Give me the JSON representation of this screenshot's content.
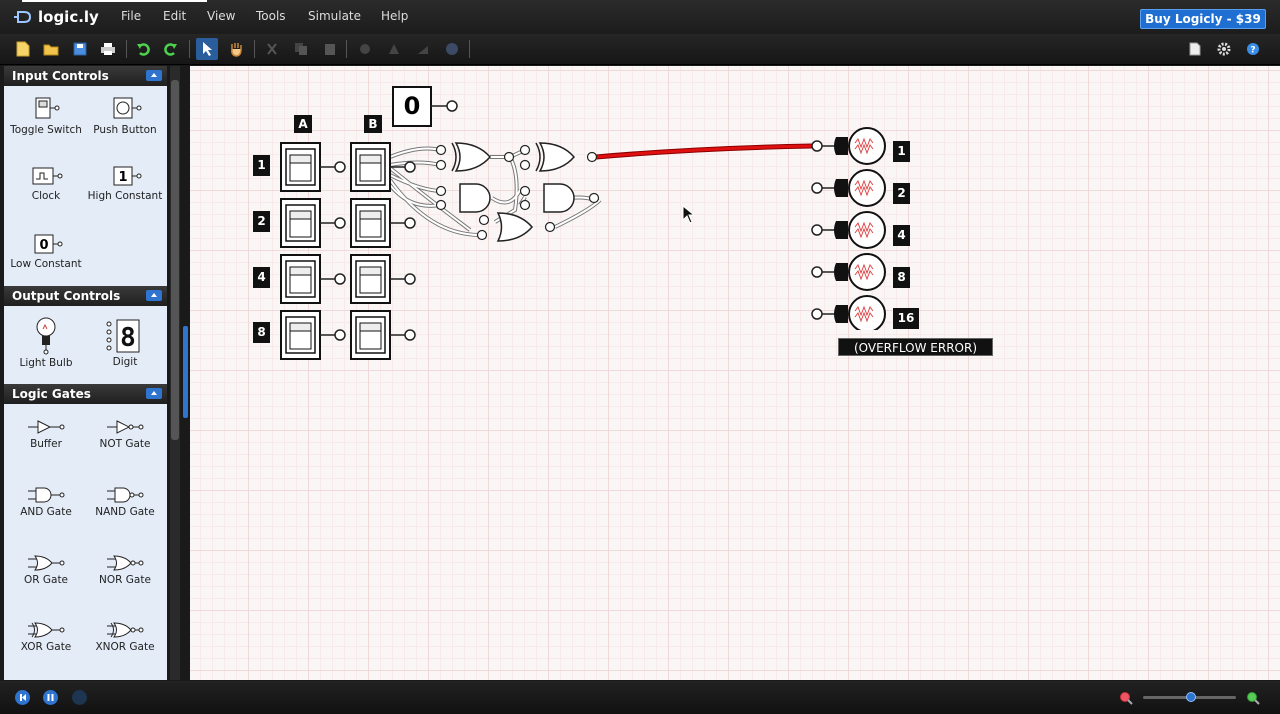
{
  "app": {
    "logo_text": "logic.ly",
    "buy_label": "Buy Logicly - $39"
  },
  "menu": [
    "File",
    "Edit",
    "View",
    "Tools",
    "Simulate",
    "Help"
  ],
  "sidebar": {
    "sections": [
      {
        "title": "Input Controls",
        "items": [
          {
            "label": "Toggle Switch",
            "icon": "toggle-switch-icon"
          },
          {
            "label": "Push Button",
            "icon": "push-button-icon"
          },
          {
            "label": "Clock",
            "icon": "clock-icon"
          },
          {
            "label": "High Constant",
            "icon": "high-constant-icon",
            "glyph": "1"
          },
          {
            "label": "Low Constant",
            "icon": "low-constant-icon",
            "glyph": "0"
          }
        ]
      },
      {
        "title": "Output Controls",
        "items": [
          {
            "label": "Light Bulb",
            "icon": "light-bulb-icon"
          },
          {
            "label": "Digit",
            "icon": "digit-icon",
            "glyph": "8"
          }
        ]
      },
      {
        "title": "Logic Gates",
        "items": [
          {
            "label": "Buffer",
            "icon": "buffer-gate-icon"
          },
          {
            "label": "NOT Gate",
            "icon": "not-gate-icon"
          },
          {
            "label": "AND Gate",
            "icon": "and-gate-icon"
          },
          {
            "label": "NAND Gate",
            "icon": "nand-gate-icon"
          },
          {
            "label": "OR Gate",
            "icon": "or-gate-icon"
          },
          {
            "label": "NOR Gate",
            "icon": "nor-gate-icon"
          },
          {
            "label": "XOR Gate",
            "icon": "xor-gate-icon"
          },
          {
            "label": "XNOR Gate",
            "icon": "xnor-gate-icon"
          }
        ]
      }
    ]
  },
  "canvas": {
    "column_labels": [
      "A",
      "B"
    ],
    "row_labels": [
      "1",
      "2",
      "4",
      "8"
    ],
    "constant_value": "0",
    "output_labels": [
      "1",
      "2",
      "4",
      "8",
      "16"
    ],
    "lit_output_index": 0,
    "overflow_label": "(OVERFLOW ERROR)",
    "active_wire_color": "#e01010",
    "wire_color": "#ffffff"
  },
  "colors": {
    "accent": "#1e6fd1",
    "panel": "#e4ecf7"
  }
}
